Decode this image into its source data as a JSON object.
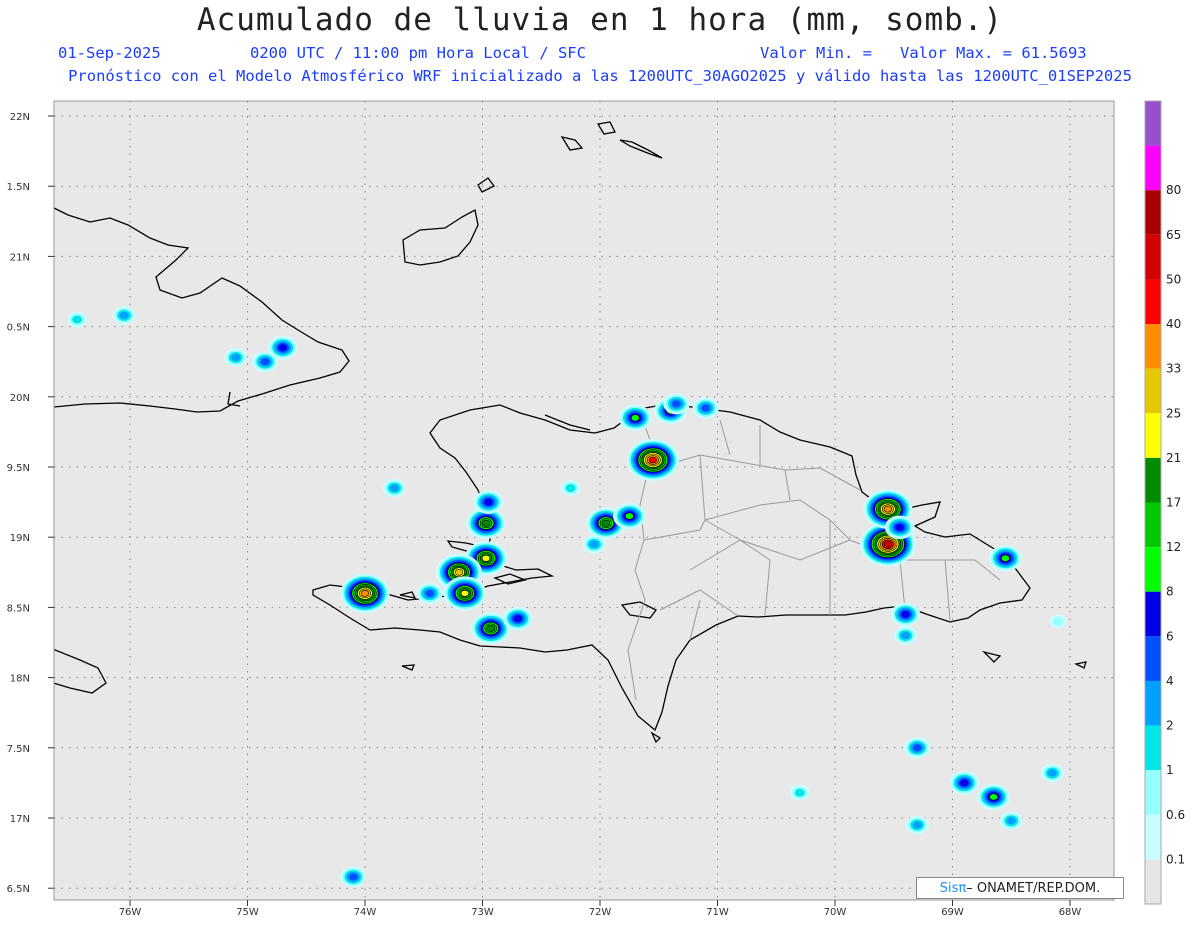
{
  "title": "Acumulado de lluvia en 1 hora (mm, somb.)",
  "date": "01-Sep-2025",
  "time": "0200 UTC / 11:00 pm Hora Local / SFC",
  "valmin": "Valor Min. =",
  "valmax": "Valor Max. = 61.5693",
  "forecast": "Pronóstico con el Modelo Atmosférico WRF inicializado a las 1200UTC_30AGO2025 y válido hasta las  1200UTC_01SEP2025",
  "credit": {
    "brand": "Sisπ",
    "rest": " – ONAMET/REP.DOM."
  },
  "colors": {
    "ocean": "#e8e8e8",
    "grid": "#888888",
    "coast": "#000000",
    "border": "#999999"
  },
  "lat_labels": [
    "22N",
    "1.5N",
    "21N",
    "0.5N",
    "20N",
    "9.5N",
    "19N",
    "8.5N",
    "18N",
    "7.5N",
    "17N",
    "6.5N"
  ],
  "lon_labels": [
    "76W",
    "75W",
    "74W",
    "73W",
    "72W",
    "71W",
    "70W",
    "69W",
    "68W"
  ],
  "colorbar": {
    "colors": [
      "#e6e6e6",
      "#c8ffff",
      "#96ffff",
      "#00e6e6",
      "#00a0ff",
      "#0050ff",
      "#0000e6",
      "#00ff00",
      "#00c800",
      "#008c00",
      "#ffff00",
      "#e6c800",
      "#ff8c00",
      "#ff0000",
      "#d20000",
      "#aa0000",
      "#ff00ff",
      "#9650c8"
    ],
    "labels": [
      "0.1",
      "0.6",
      "1",
      "2",
      "4",
      "6",
      "8",
      "12",
      "17",
      "21",
      "25",
      "33",
      "40",
      "50",
      "65",
      "80"
    ]
  },
  "chart_data": {
    "type": "heatmap",
    "title": "Acumulado de lluvia en 1 hora (mm, somb.)",
    "lat_range": [
      16.5,
      22.0
    ],
    "lon_range": [
      -76.7,
      -67.6
    ],
    "max_value": 61.5693,
    "rain_cells": [
      {
        "lon": -71.55,
        "lat": 19.55,
        "value": 40
      },
      {
        "lon": -71.7,
        "lat": 19.85,
        "value": 8
      },
      {
        "lon": -71.4,
        "lat": 19.9,
        "value": 8
      },
      {
        "lon": -71.1,
        "lat": 19.92,
        "value": 4
      },
      {
        "lon": -71.35,
        "lat": 19.95,
        "value": 4
      },
      {
        "lon": -71.95,
        "lat": 19.1,
        "value": 17
      },
      {
        "lon": -71.75,
        "lat": 19.15,
        "value": 8
      },
      {
        "lon": -72.05,
        "lat": 18.95,
        "value": 2
      },
      {
        "lon": -69.55,
        "lat": 18.95,
        "value": 61.5
      },
      {
        "lon": -69.55,
        "lat": 19.2,
        "value": 33
      },
      {
        "lon": -69.45,
        "lat": 19.07,
        "value": 6
      },
      {
        "lon": -68.55,
        "lat": 18.85,
        "value": 8
      },
      {
        "lon": -69.4,
        "lat": 18.45,
        "value": 6
      },
      {
        "lon": -69.4,
        "lat": 18.3,
        "value": 2
      },
      {
        "lon": -72.97,
        "lat": 18.85,
        "value": 21
      },
      {
        "lon": -72.97,
        "lat": 19.1,
        "value": 17
      },
      {
        "lon": -72.95,
        "lat": 19.25,
        "value": 6
      },
      {
        "lon": -73.2,
        "lat": 18.75,
        "value": 25
      },
      {
        "lon": -73.15,
        "lat": 18.6,
        "value": 21
      },
      {
        "lon": -72.93,
        "lat": 18.35,
        "value": 17
      },
      {
        "lon": -72.7,
        "lat": 18.42,
        "value": 6
      },
      {
        "lon": -73.45,
        "lat": 18.6,
        "value": 4
      },
      {
        "lon": -74.0,
        "lat": 18.6,
        "value": 33
      },
      {
        "lon": -73.75,
        "lat": 19.35,
        "value": 2
      },
      {
        "lon": -74.1,
        "lat": 16.58,
        "value": 4
      },
      {
        "lon": -69.3,
        "lat": 17.5,
        "value": 4
      },
      {
        "lon": -68.9,
        "lat": 17.25,
        "value": 6
      },
      {
        "lon": -68.65,
        "lat": 17.15,
        "value": 8
      },
      {
        "lon": -68.5,
        "lat": 16.98,
        "value": 2
      },
      {
        "lon": -68.15,
        "lat": 17.32,
        "value": 2
      },
      {
        "lon": -69.3,
        "lat": 16.95,
        "value": 2
      },
      {
        "lon": -70.3,
        "lat": 17.18,
        "value": 1
      },
      {
        "lon": -74.7,
        "lat": 20.35,
        "value": 6
      },
      {
        "lon": -74.85,
        "lat": 20.25,
        "value": 4
      },
      {
        "lon": -75.1,
        "lat": 20.28,
        "value": 2
      },
      {
        "lon": -76.05,
        "lat": 20.58,
        "value": 2
      },
      {
        "lon": -76.45,
        "lat": 20.55,
        "value": 1
      },
      {
        "lon": -72.25,
        "lat": 19.35,
        "value": 1
      },
      {
        "lon": -68.1,
        "lat": 18.4,
        "value": 0.6
      }
    ]
  }
}
